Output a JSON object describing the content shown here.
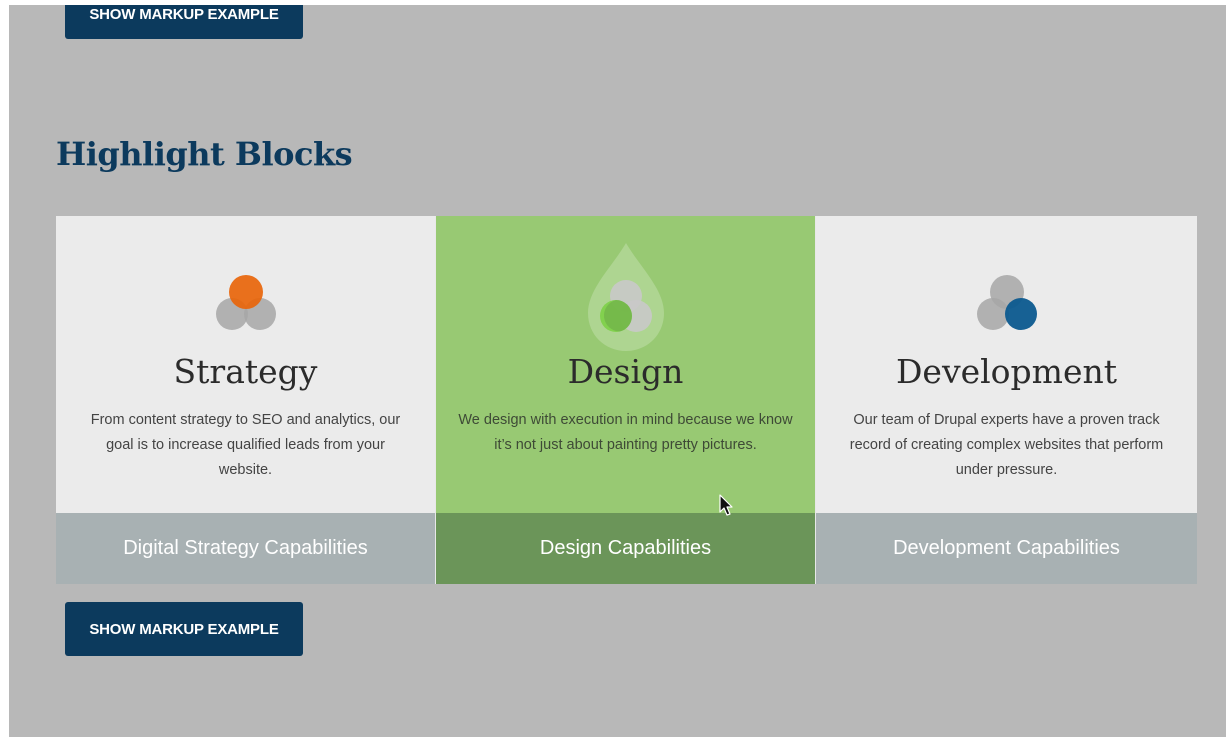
{
  "buttons": {
    "top_label": "SHOW MARKUP EXAMPLE",
    "bottom_label": "SHOW MARKUP EXAMPLE"
  },
  "section": {
    "title": "Highlight Blocks"
  },
  "blocks": [
    {
      "title": "Strategy",
      "text": "From content strategy to SEO and analytics, our goal is to increase qualified leads from your website.",
      "link": "Digital Strategy Capabilities",
      "icon": "venn-orange-icon",
      "accent": "#e8650a"
    },
    {
      "title": "Design",
      "text": "We design with execution in mind because we know it’s not just about painting pretty pictures.",
      "link": "Design Capabilities",
      "icon": "venn-drop-green-icon",
      "accent": "#7fd14b"
    },
    {
      "title": "Development",
      "text": "Our team of Drupal experts have a proven track record of creating complex websites that perform under pressure.",
      "link": "Development Capabilities",
      "icon": "venn-blue-icon",
      "accent": "#0c5a8f"
    }
  ],
  "colors": {
    "page_background": "#b8b8b8",
    "button": "#0c3a5d",
    "title": "#0c3a5d",
    "block_background": "#ebebeb",
    "block_active_background": "#98c973",
    "footer": "#a8b1b3",
    "footer_active": "#6b9559"
  }
}
